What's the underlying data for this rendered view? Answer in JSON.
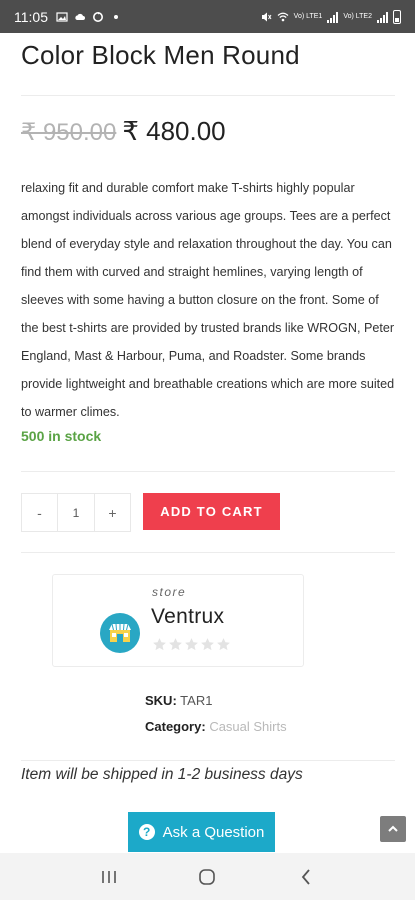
{
  "status_bar": {
    "time": "11:05",
    "lte_label_1": "Vo) LTE1",
    "lte_label_2": "Vo) LTE2"
  },
  "product": {
    "title": "Color Block Men Round",
    "old_price": "₹ 950.00",
    "new_price": "₹ 480.00",
    "description": " relaxing fit and durable comfort make T-shirts highly popular amongst individuals across various age groups. Tees are a perfect blend of everyday style and relaxation throughout the day. You can find them with curved and straight hemlines, varying length of sleeves with some having a button closure on the front. Some of the best t-shirts are provided by trusted brands like WROGN, Peter England, Mast & Harbour, Puma, and Roadster. Some brands provide lightweight and breathable creations which are more suited to warmer climes.",
    "stock": "500 in stock"
  },
  "cart": {
    "minus_label": "-",
    "quantity": "1",
    "plus_label": "+",
    "add_to_cart_label": "ADD TO CART"
  },
  "store": {
    "label": "store",
    "name": "Ventrux",
    "rating": 0,
    "rating_max": 5
  },
  "meta": {
    "sku_label": "SKU:",
    "sku_value": "TAR1",
    "category_label": "Category:",
    "category_value": "Casual Shirts"
  },
  "shipping_note": "Item will be shipped in 1-2 business days",
  "ask_question_label": "Ask a Question",
  "colors": {
    "add_to_cart": "#ef3f4d",
    "ask_button": "#1ca9c9",
    "stock_green": "#5aa345",
    "store_logo": "#29a7c4"
  },
  "icons": {
    "status_left": [
      "gallery-icon",
      "cloud-icon",
      "sync-icon"
    ],
    "status_right": [
      "mute-icon",
      "wifi-icon",
      "signal-icon",
      "battery-icon"
    ],
    "nav": [
      "recent-apps-icon",
      "home-icon",
      "back-icon"
    ],
    "question": "question-circle-icon",
    "scroll_top": "chevron-up-icon"
  }
}
